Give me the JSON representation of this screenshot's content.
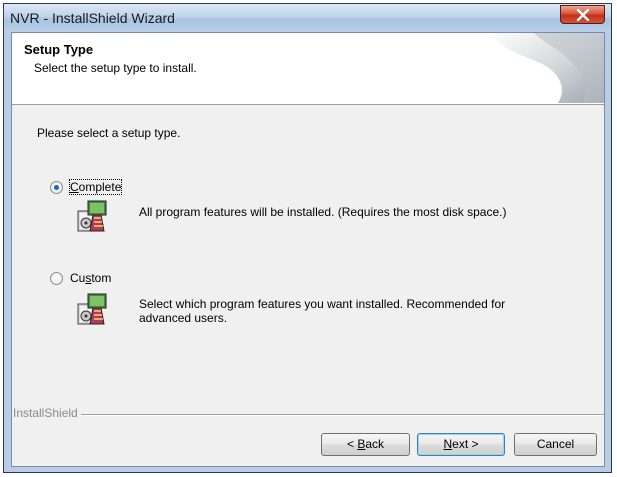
{
  "window": {
    "title": "NVR - InstallShield Wizard"
  },
  "header": {
    "title": "Setup Type",
    "subtitle": "Select the setup type to install."
  },
  "prompt": "Please select a setup type.",
  "options": [
    {
      "label_pre": "",
      "label_key": "C",
      "label_post": "omplete",
      "checked": true,
      "description": "All program features will be installed. (Requires the most disk space.)"
    },
    {
      "label_pre": "Cu",
      "label_key": "s",
      "label_post": "tom",
      "checked": false,
      "description": "Select which program features you want installed. Recommended for advanced users."
    }
  ],
  "footer": {
    "brand": "InstallShield"
  },
  "buttons": {
    "back": {
      "lt": "< ",
      "key": "B",
      "rest": "ack"
    },
    "next": {
      "key": "N",
      "rest": "ext >"
    },
    "cancel": "Cancel"
  },
  "colors": {
    "title_bar": "#bfd3ea",
    "close_button": "#c1321a",
    "radio_dot": "#1c63c8",
    "default_border": "#3c7fb1"
  }
}
